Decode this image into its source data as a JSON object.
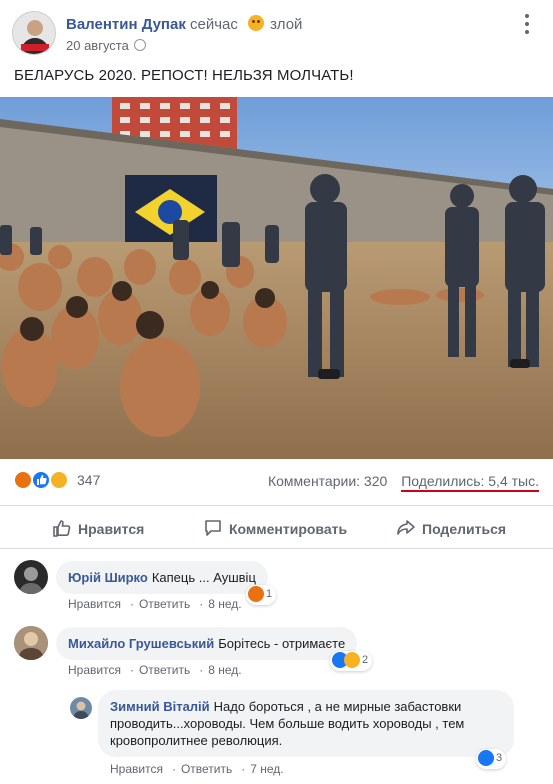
{
  "header": {
    "author": "Валентин Дупак",
    "time_word": "сейчас",
    "feeling": "злой",
    "date": "20 августа",
    "more_icon": "more-dots-icon",
    "privacy_icon": "globe-icon"
  },
  "post": {
    "text": "БЕЛАРУСЬ 2020. РЕПОСТ! НЕЛЬЗЯ МОЛЧАТЬ!"
  },
  "reactions": {
    "icons": [
      "angry-icon",
      "like-icon",
      "haha-icon"
    ],
    "count": "347",
    "comments_label": "Комментарии: 320",
    "shares_label": "Поделились: 5,4 тыс."
  },
  "actions": {
    "like": "Нравится",
    "comment": "Комментировать",
    "share": "Поделиться"
  },
  "comments": [
    {
      "author": "Юрій Ширко",
      "text": "Капець ... Аушвіц",
      "like": "Нравится",
      "reply": "Ответить",
      "time": "8 нед.",
      "reaction_count": "1"
    },
    {
      "author": "Михайло Грушевський",
      "text": "Борітесь - отримаєте",
      "like": "Нравится",
      "reply": "Ответить",
      "time": "8 нед.",
      "reaction_count": "2"
    },
    {
      "author": "Зимний Віталій",
      "text_line1": "Надо бороться , а не мирные забастовки",
      "text_line2": "проводить...хороводы. Чем больше водить хороводы , тем",
      "text_line3": "кровопролитнее революция.",
      "like": "Нравится",
      "reply": "Ответить",
      "time": "7 нед.",
      "reaction_count": "3"
    }
  ],
  "colors": {
    "link": "#385898",
    "meta": "#606770",
    "bubble": "#f2f3f5",
    "like_blue": "#1877f2",
    "angry_orange": "#e9710f",
    "underline_red": "#d0021b"
  }
}
